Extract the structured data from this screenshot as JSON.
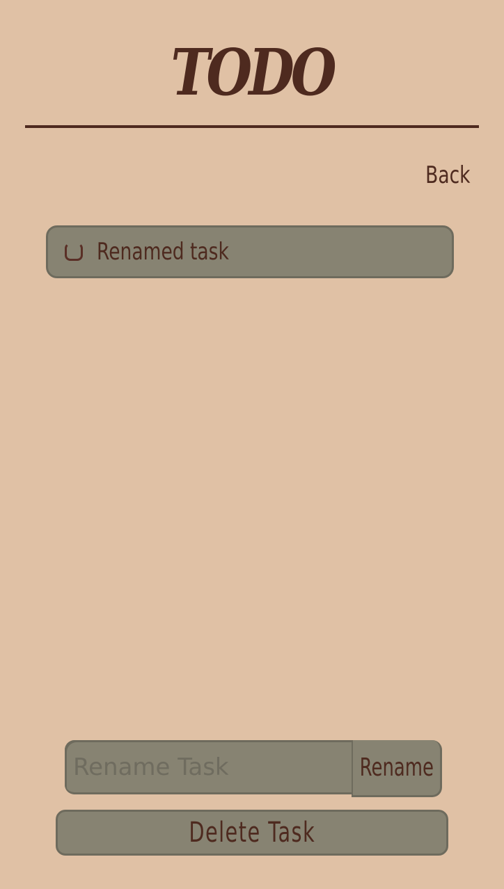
{
  "header": {
    "title": "TODO"
  },
  "nav": {
    "back_label": "Back"
  },
  "task": {
    "name": "Renamed task",
    "completed": false
  },
  "rename": {
    "placeholder": "Rename Task",
    "value": "",
    "button_label": "Rename"
  },
  "actions": {
    "delete_label": "Delete Task"
  },
  "colors": {
    "background": "#e0c1a5",
    "card": "#878372",
    "card_border": "#6e6b5d",
    "text": "#4e2a1f"
  }
}
